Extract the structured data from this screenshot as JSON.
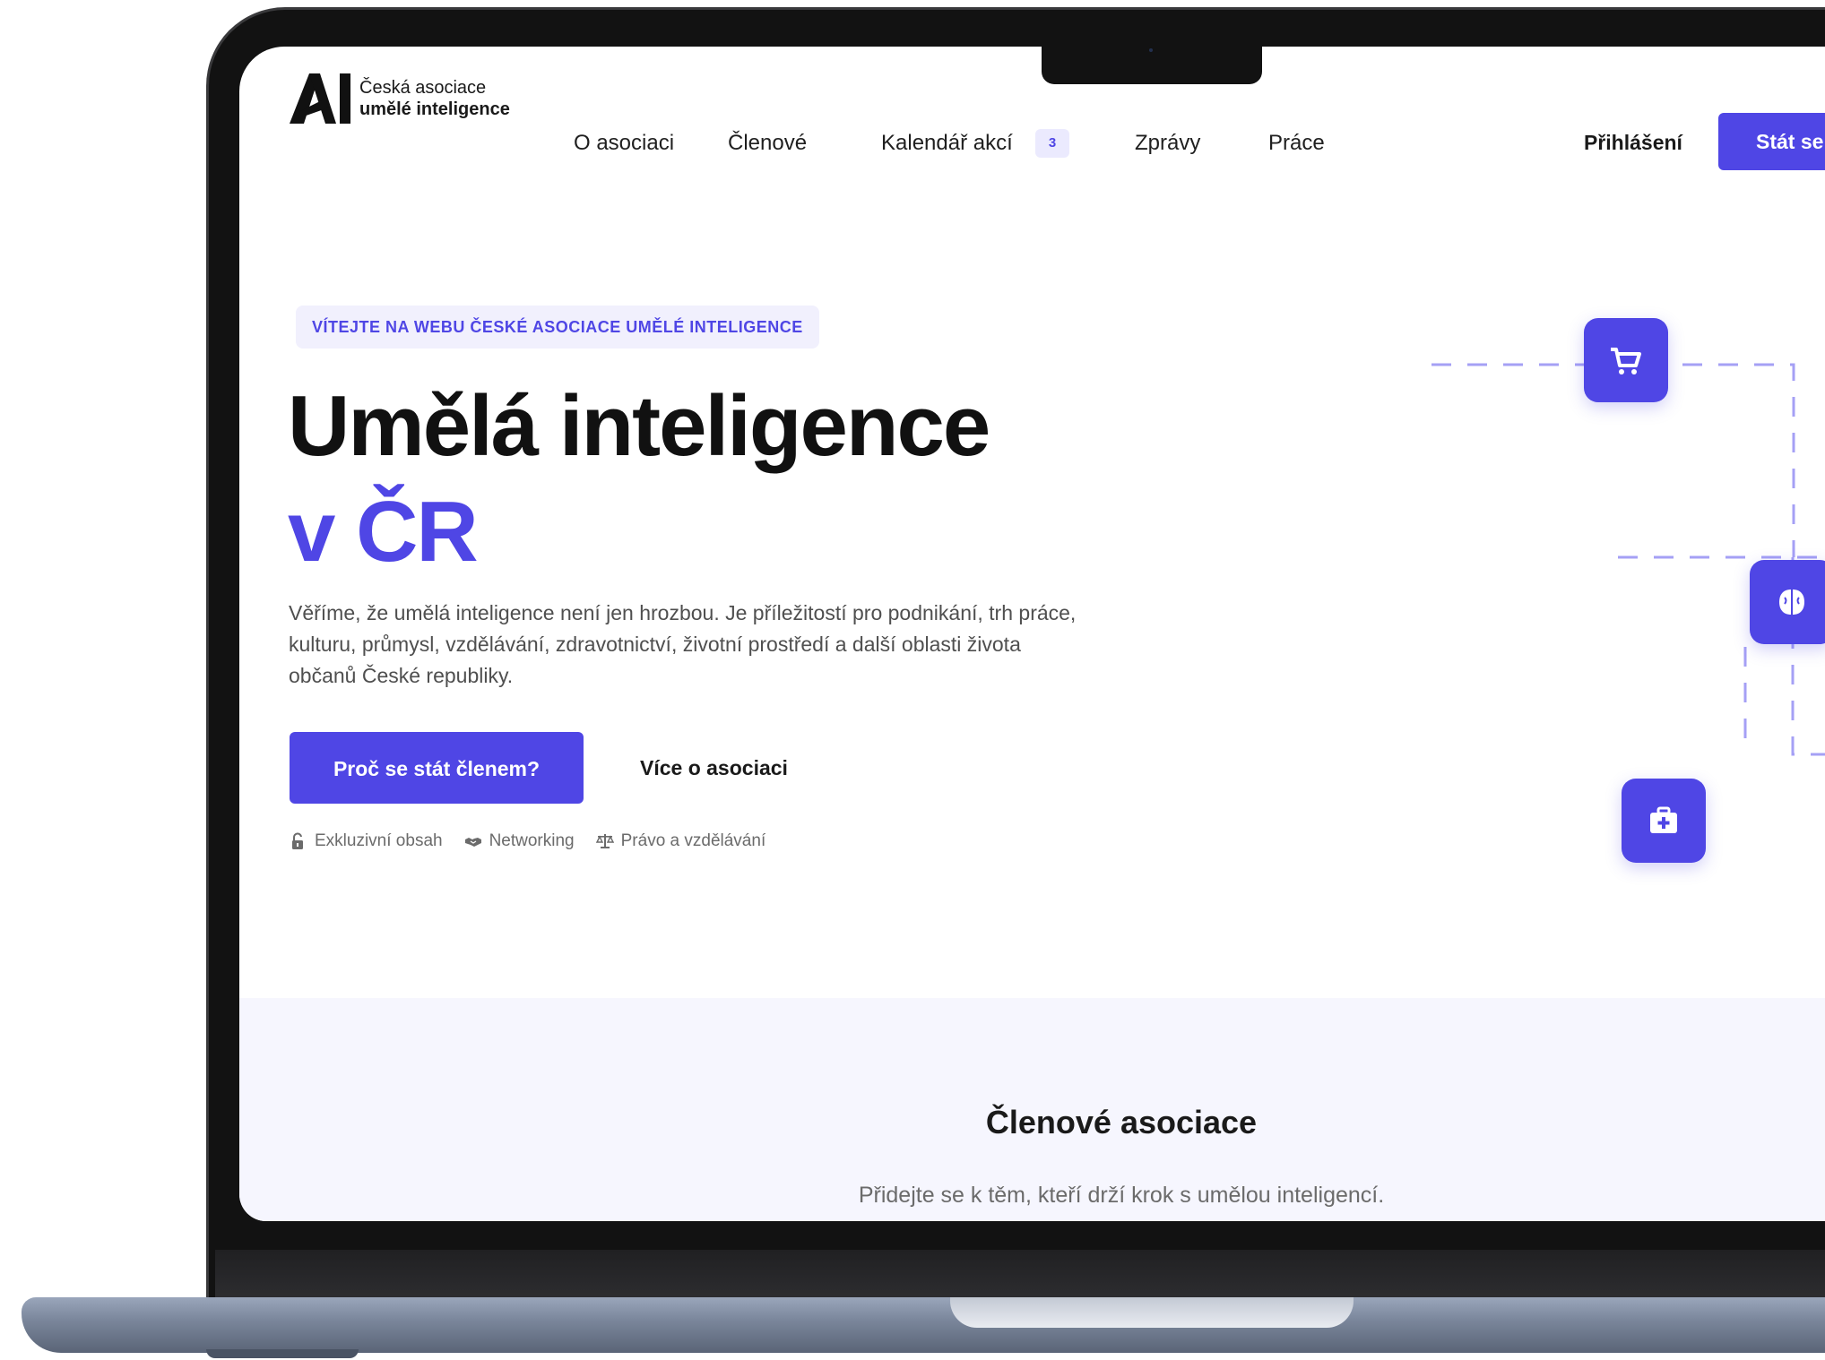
{
  "brand": {
    "line1": "Česká asociace",
    "line2": "umělé inteligence",
    "accent": "#4f46e5"
  },
  "nav": {
    "items": [
      "O asociaci",
      "Členové",
      "Kalendář akcí",
      "Zprávy",
      "Práce"
    ],
    "events_count": "3",
    "login": "Přihlášení",
    "join": "Stát se"
  },
  "hero": {
    "eyebrow": "VÍTEJTE NA WEBU ČESKÉ ASOCIACE UMĚLÉ INTELIGENCE",
    "title_line1": "Umělá inteligence",
    "title_line2": "v ČR",
    "lead": "Věříme, že umělá inteligence není jen hrozbou. Je příležitostí pro podnikání, trh práce, kulturu, průmysl, vzdělávání, zdravotnictví, životní prostředí a další oblasti života občanů České republiky.",
    "cta_primary": "Proč se stát členem?",
    "cta_secondary": "Více o asociaci",
    "features": [
      {
        "icon": "lock-open-icon",
        "label": "Exkluzivní obsah"
      },
      {
        "icon": "handshake-icon",
        "label": "Networking"
      },
      {
        "icon": "scale-icon",
        "label": "Právo a vzdělávání"
      }
    ]
  },
  "diagram": {
    "nodes": [
      "cart-icon",
      "brain-icon",
      "medkit-icon",
      "leaf-icon"
    ]
  },
  "members": {
    "title": "Členové asociace",
    "subtitle": "Přidejte se k těm, kteří drží krok s umělou inteligencí."
  }
}
